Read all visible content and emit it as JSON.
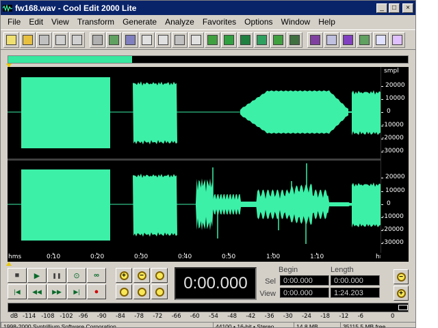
{
  "window": {
    "title": "fw168.wav - Cool Edit 2000 Lite",
    "minimize_glyph": "_",
    "maximize_glyph": "□",
    "close_glyph": "×"
  },
  "menu": [
    {
      "label": "File"
    },
    {
      "label": "Edit"
    },
    {
      "label": "View"
    },
    {
      "label": "Transform"
    },
    {
      "label": "Generate"
    },
    {
      "label": "Analyze"
    },
    {
      "label": "Favorites"
    },
    {
      "label": "Options"
    },
    {
      "label": "Window"
    },
    {
      "label": "Help"
    }
  ],
  "toolbar_icons": [
    "new-file-icon",
    "open-file-icon",
    "close-file-icon",
    "save-icon",
    "save-as-icon",
    "undo-icon",
    "repeat-icon",
    "mix-paste-icon",
    "copy-to-new-icon",
    "copy-icon",
    "cut-icon",
    "paste-icon",
    "trim-icon",
    "amplify-icon",
    "noise-reduction-icon",
    "normalize-icon",
    "envelope-icon",
    "frequency-analysis-icon",
    "waveform-view-icon",
    "spectral-view-icon",
    "markers-icon",
    "info-icon",
    "preferences-icon",
    "cd-icon"
  ],
  "overview": {
    "visible_fraction": 0.31
  },
  "waveform": {
    "fill_color": "#3cf0a8",
    "background": "#000000",
    "amplitude_unit": "smpl",
    "amplitude_ticks": [
      "20000",
      "10000",
      "0",
      "-10000",
      "-20000",
      "-30000"
    ],
    "time_unit": "hms",
    "time_ticks": [
      "0:10",
      "0:20",
      "0:30",
      "0:40",
      "0:50",
      "1:00",
      "1:10"
    ]
  },
  "transport": {
    "stop": "■",
    "play": "▶",
    "pause": "❚❚",
    "play_to_end": "⊙",
    "loop": "∞",
    "go_start": "|◀",
    "rewind": "◀◀",
    "fast_forward": "▶▶",
    "go_end": "▶|",
    "record": "●"
  },
  "time_display": "0:00.000",
  "selection": {
    "begin_label": "Begin",
    "length_label": "Length",
    "sel_label": "Sel",
    "view_label": "View",
    "sel_begin": "0:00.000",
    "sel_length": "0:00.000",
    "view_begin": "0:00.000",
    "view_length": "1:24.203"
  },
  "level_meter": {
    "ticks": [
      "dB",
      "-114",
      "-108",
      "-102",
      "-96",
      "-90",
      "-84",
      "-78",
      "-72",
      "-66",
      "-60",
      "-54",
      "-48",
      "-42",
      "-36",
      "-30",
      "-24",
      "-18",
      "-12",
      "-6",
      "0"
    ]
  },
  "status": {
    "cell1": "1998-2000 Syntrillium Software Corporation",
    "cell2": "44100 • 16-bit • Stereo",
    "cell3": "14.8 MB",
    "cell4": "35115.5 MB free"
  }
}
